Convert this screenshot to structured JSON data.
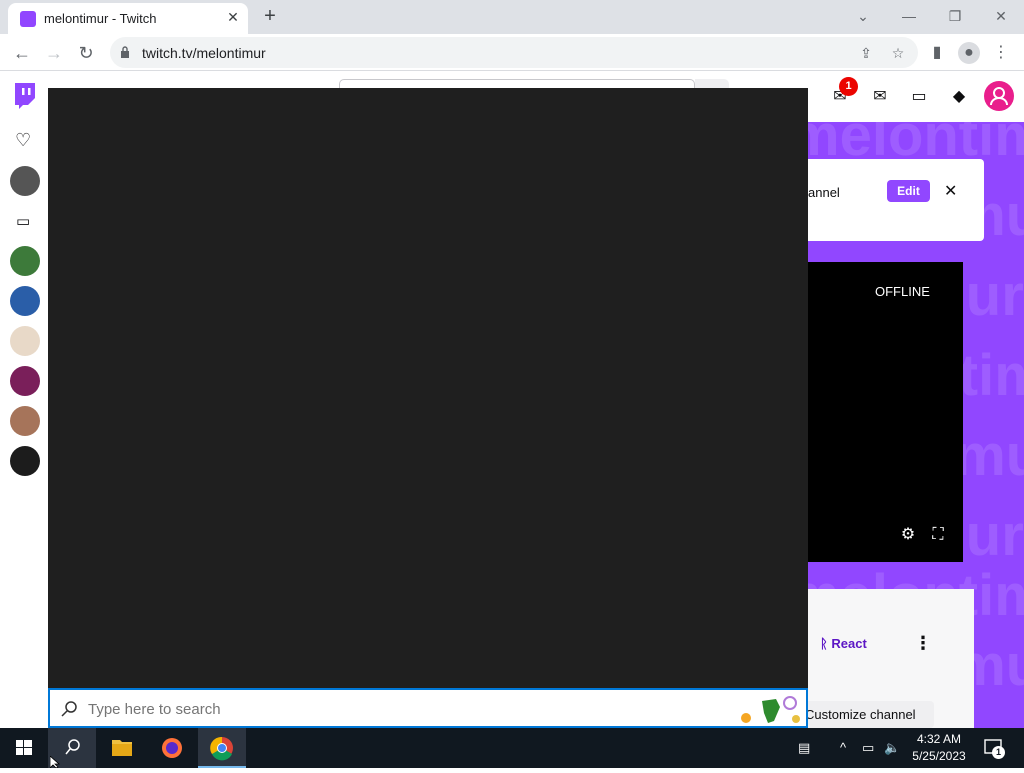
{
  "browser": {
    "tab_title": "melontimur - Twitch",
    "url": "twitch.tv/melontimur",
    "new_tab_label": "+",
    "close_tab_label": "✕"
  },
  "twitch": {
    "notification_count": "1",
    "card_text": "annel",
    "edit_label": "Edit",
    "offline_label": "OFFLINE",
    "react_label": "React",
    "customize_label": "Customize channel",
    "banner_watermark": "melontimur",
    "accent_color": "#9147ff"
  },
  "search": {
    "placeholder": "Type here to search"
  },
  "taskbar": {
    "time": "4:32 AM",
    "date": "5/25/2023",
    "notification_badge": "1"
  }
}
